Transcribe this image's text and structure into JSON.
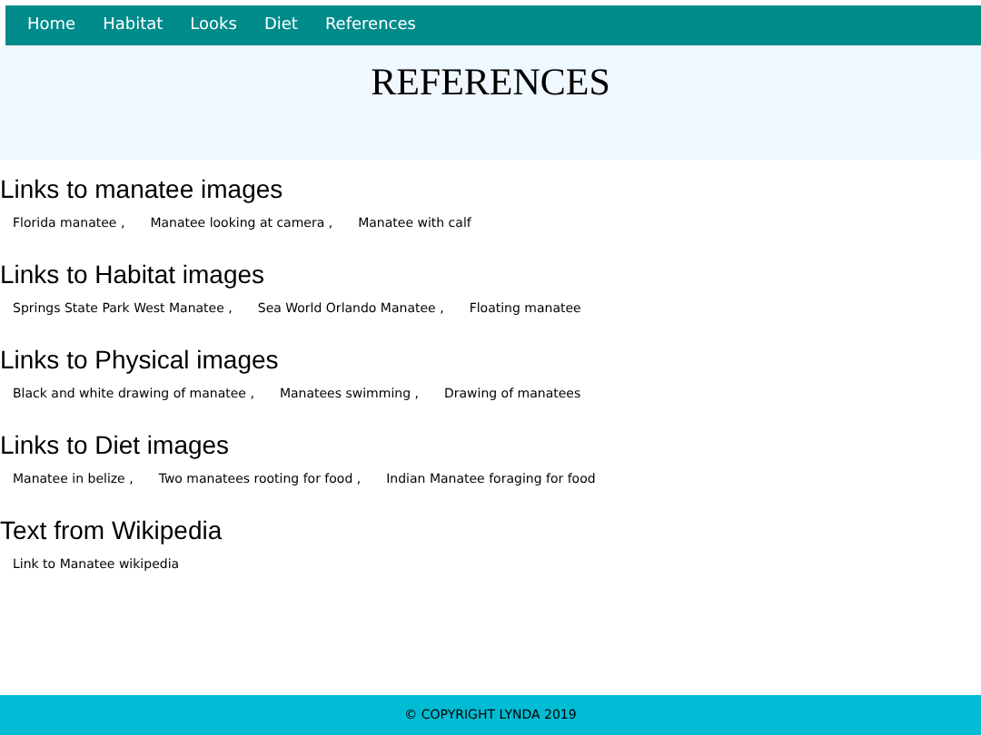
{
  "nav": [
    {
      "label": "Home"
    },
    {
      "label": "Habitat"
    },
    {
      "label": "Looks"
    },
    {
      "label": "Diet"
    },
    {
      "label": "References"
    }
  ],
  "header": {
    "title": "REFERENCES"
  },
  "sections": [
    {
      "heading": "Links to manatee images",
      "links": [
        "Florida manatee ,",
        "Manatee looking at camera ,",
        "Manatee with calf"
      ]
    },
    {
      "heading": "Links to Habitat images",
      "links": [
        "Springs State Park West Manatee ,",
        "Sea World Orlando Manatee ,",
        "Floating manatee"
      ]
    },
    {
      "heading": "Links to Physical images",
      "links": [
        "Black and white drawing of manatee ,",
        "Manatees swimming ,",
        "Drawing of manatees"
      ]
    },
    {
      "heading": "Links to Diet images",
      "links": [
        "Manatee in belize ,",
        "Two manatees rooting for food ,",
        "Indian Manatee foraging for food"
      ]
    },
    {
      "heading": "Text from Wikipedia",
      "links": [
        "Link to Manatee wikipedia"
      ]
    }
  ],
  "footer": {
    "text": "© COPYRIGHT LYNDA 2019"
  }
}
